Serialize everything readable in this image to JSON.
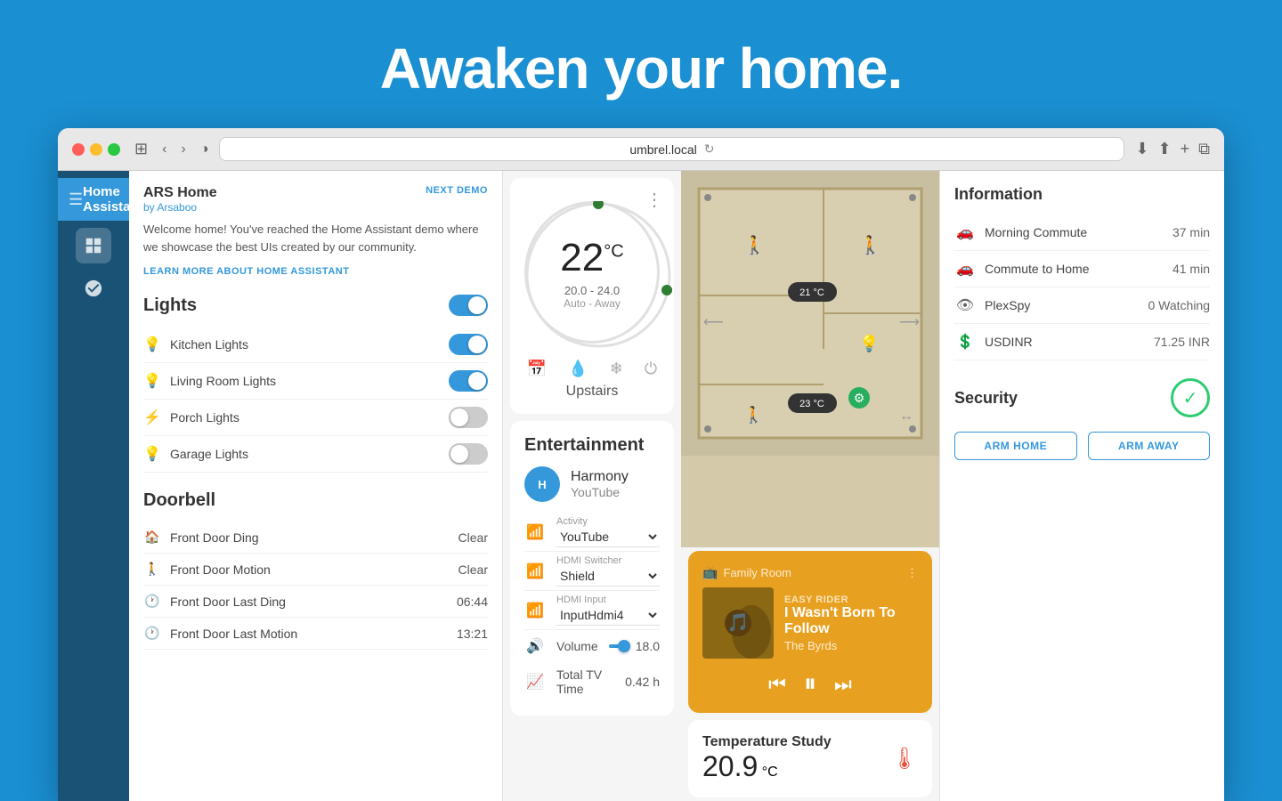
{
  "hero": {
    "title": "Awaken your home."
  },
  "browser": {
    "url": "umbrel.local",
    "tab_title": "Home Assistant"
  },
  "nav": {
    "app_title": "Home Assistant"
  },
  "left_panel": {
    "home_name": "ARS Home",
    "home_sub": "by Arsaboo",
    "next_demo": "NEXT DEMO",
    "welcome_text": "Welcome home! You've reached the Home Assistant demo where we showcase the best UIs created by our community.",
    "learn_link": "LEARN MORE ABOUT HOME ASSISTANT",
    "lights_title": "Lights",
    "lights": [
      {
        "name": "Kitchen Lights",
        "icon": "💡",
        "on": true
      },
      {
        "name": "Living Room Lights",
        "icon": "💡",
        "on": true
      },
      {
        "name": "Porch Lights",
        "icon": "⚡",
        "on": false
      },
      {
        "name": "Garage Lights",
        "icon": "💡",
        "on": false
      }
    ],
    "doorbell_title": "Doorbell",
    "doorbell_items": [
      {
        "name": "Front Door Ding",
        "icon": "🏠",
        "value": "Clear"
      },
      {
        "name": "Front Door Motion",
        "icon": "🚶",
        "value": "Clear"
      },
      {
        "name": "Front Door Last Ding",
        "icon": "🕐",
        "value": "06:44"
      },
      {
        "name": "Front Door Last Motion",
        "icon": "🕐",
        "value": "13:21"
      }
    ]
  },
  "thermostat": {
    "temperature": "22",
    "unit": "°C",
    "range": "20.0 - 24.0",
    "mode": "Auto - Away",
    "name": "Upstairs"
  },
  "entertainment": {
    "title": "Entertainment",
    "device_name": "Harmony",
    "device_activity": "YouTube",
    "activity_label": "Activity",
    "activity_value": "YouTube",
    "hdmi_switcher_label": "HDMI Switcher",
    "hdmi_switcher_value": "Shield",
    "hdmi_input_label": "HDMI Input",
    "hdmi_input_value": "InputHdmi4",
    "volume_label": "Volume",
    "volume_value": "18.0",
    "tv_time_label": "Total TV Time",
    "tv_time_value": "0.42 h"
  },
  "music": {
    "room": "Family Room",
    "title": "I Wasn't Born To Follow",
    "artist": "The Byrds"
  },
  "temperature_study": {
    "label": "Temperature Study",
    "value": "20.9",
    "unit": "°C"
  },
  "information": {
    "title": "Information",
    "items": [
      {
        "label": "Morning Commute",
        "value": "37 min",
        "icon": "🚗"
      },
      {
        "label": "Commute to Home",
        "value": "41 min",
        "icon": "🚗"
      },
      {
        "label": "PlexSpy",
        "value": "0 Watching",
        "icon": "👁"
      },
      {
        "label": "USDINR",
        "value": "71.25 INR",
        "icon": "💲"
      }
    ]
  },
  "security": {
    "title": "Security",
    "arm_home": "ARM HOME",
    "arm_away": "ARM AWAY"
  }
}
